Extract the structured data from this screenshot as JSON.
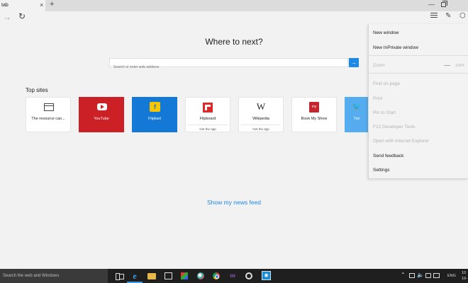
{
  "tabbar": {
    "tab_title": "tab",
    "close_glyph": "×",
    "new_tab_glyph": "+",
    "minimize_glyph": "—"
  },
  "navbar": {
    "forward_glyph": "→",
    "refresh_glyph": "↻",
    "note_glyph": "✎",
    "share_glyph": "⬡"
  },
  "main": {
    "heading": "Where to next?",
    "search_placeholder": "Search or enter web address",
    "search_go_glyph": "→",
    "top_sites_label": "Top sites",
    "news_feed_link": "Show my news feed"
  },
  "top_sites": [
    {
      "name": "The resource can...",
      "icon": "window-icon"
    },
    {
      "name": "YouTube",
      "icon": "youtube-icon",
      "color": "#cc2027"
    },
    {
      "name": "Flipkart",
      "icon": "flipkart-icon",
      "color": "#1479d6"
    },
    {
      "name": "Flipboard",
      "icon": "flipboard-icon",
      "sub": "Get the app"
    },
    {
      "name": "Wikipedia",
      "icon": "wikipedia-icon",
      "sub": "Get the app",
      "glyph": "W"
    },
    {
      "name": "Book My Show",
      "icon": "bookmyshow-icon"
    },
    {
      "name": "Twi",
      "icon": "twitter-icon",
      "color": "#55acee"
    }
  ],
  "menu": {
    "new_window": "New window",
    "new_inprivate_window": "New InPrivate window",
    "zoom_label": "Zoom",
    "zoom_value": "125%",
    "find_on_page": "Find on page",
    "print": "Print",
    "pin_to_start": "Pin to Start",
    "f12_tools": "F12 Developer Tools",
    "open_with_ie": "Open with Internet Explorer",
    "send_feedback": "Send feedback",
    "settings": "Settings"
  },
  "taskbar": {
    "search_placeholder": "Search the web and Windows",
    "language": "ENG",
    "clock_time": "10",
    "clock_date": "19-"
  },
  "colors": {
    "accent": "#1e88e5",
    "youtube": "#cc2027",
    "flipkart": "#1479d6",
    "twitter": "#55acee"
  }
}
